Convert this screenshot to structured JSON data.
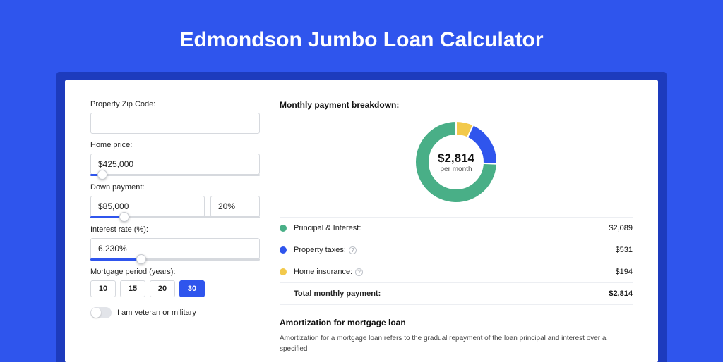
{
  "title": "Edmondson Jumbo Loan Calculator",
  "form": {
    "zip_label": "Property Zip Code:",
    "zip_value": "",
    "home_price_label": "Home price:",
    "home_price_value": "$425,000",
    "home_price_slider_pct": 7,
    "down_payment_label": "Down payment:",
    "down_payment_value": "$85,000",
    "down_payment_pct_value": "20%",
    "down_payment_slider_pct": 20,
    "interest_label": "Interest rate (%):",
    "interest_value": "6.230%",
    "interest_slider_pct": 30,
    "period_label": "Mortgage period (years):",
    "period_options": [
      "10",
      "15",
      "20",
      "30"
    ],
    "period_selected": "30",
    "veteran_label": "I am veteran or military"
  },
  "breakdown": {
    "heading": "Monthly payment breakdown:",
    "center_amount": "$2,814",
    "center_sub": "per month",
    "items": [
      {
        "label": "Principal & Interest:",
        "value": "$2,089",
        "color": "#49af87",
        "info": false
      },
      {
        "label": "Property taxes:",
        "value": "$531",
        "color": "#2f55ed",
        "info": true
      },
      {
        "label": "Home insurance:",
        "value": "$194",
        "color": "#f2c94c",
        "info": true
      }
    ],
    "total_label": "Total monthly payment:",
    "total_value": "$2,814"
  },
  "chart_data": {
    "type": "pie",
    "title": "Monthly payment breakdown",
    "series": [
      {
        "name": "Principal & Interest",
        "value": 2089,
        "color": "#49af87"
      },
      {
        "name": "Property taxes",
        "value": 531,
        "color": "#2f55ed"
      },
      {
        "name": "Home insurance",
        "value": 194,
        "color": "#f2c94c"
      }
    ],
    "total": 2814,
    "center_label": "$2,814 per month"
  },
  "amortization": {
    "heading": "Amortization for mortgage loan",
    "text": "Amortization for a mortgage loan refers to the gradual repayment of the loan principal and interest over a specified"
  }
}
